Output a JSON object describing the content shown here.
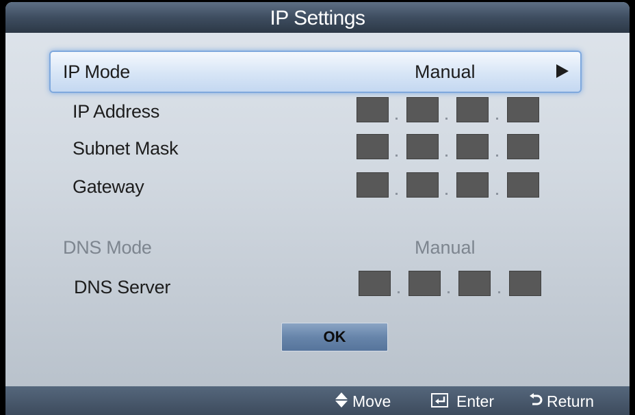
{
  "dialog": {
    "title": "IP Settings"
  },
  "rows": [
    {
      "label": "IP Mode",
      "value": "Manual",
      "selected": true,
      "has_arrow": true
    },
    {
      "label": "IP Address"
    },
    {
      "label": "Subnet Mask"
    },
    {
      "label": "Gateway"
    },
    {
      "label": "DNS Mode",
      "value": "Manual",
      "dimmed": true
    },
    {
      "label": "DNS Server"
    }
  ],
  "ok_button": {
    "label": "OK"
  },
  "footer": {
    "hints": [
      {
        "icon": "up-down-arrows-icon",
        "label": "Move"
      },
      {
        "icon": "enter-key-icon",
        "label": "Enter"
      },
      {
        "icon": "return-arrow-icon",
        "label": "Return"
      }
    ]
  },
  "colors": {
    "title_bar": "#3e4d60",
    "selection_glow": "#7ea8dd",
    "octet_fill": "#585858",
    "ok_button": "#6785aa",
    "dimmed_text": "#7d858f"
  }
}
